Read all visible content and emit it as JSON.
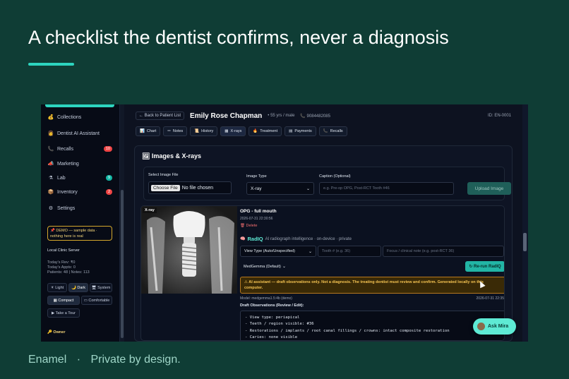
{
  "slide": {
    "title": "A checklist the dentist confirms, never a diagnosis",
    "footer_brand": "Enamel",
    "footer_sep": "·",
    "footer_tagline": "Private by design.",
    "accent_color": "#2dd4bf",
    "background_color": "#0f3d35"
  },
  "sidebar": {
    "items": [
      {
        "icon": "money-bag-icon",
        "glyph": "💰",
        "label": "Collections"
      },
      {
        "icon": "dentist-icon",
        "glyph": "👩",
        "label": "Dentist AI Assistant"
      },
      {
        "icon": "phone-icon",
        "glyph": "📞",
        "label": "Recalls",
        "badge": "10",
        "badge_color": "#ef4444"
      },
      {
        "icon": "megaphone-icon",
        "glyph": "📣",
        "label": "Marketing"
      },
      {
        "icon": "flask-icon",
        "glyph": "⚗",
        "label": "Lab",
        "badge": "9",
        "badge_color": "#14b8a6"
      },
      {
        "icon": "box-icon",
        "glyph": "📦",
        "label": "Inventory",
        "badge": "2",
        "badge_color": "#ef4444"
      },
      {
        "icon": "gear-icon",
        "glyph": "⚙",
        "label": "Settings"
      }
    ],
    "demo_line1": "📌 DEMO — sample data ·",
    "demo_line2": "nothing here is real",
    "server_label": "Local Clinic Server",
    "stats_rev": "Today's Rev: ₹0",
    "stats_appts": "Today's Appts: 0",
    "stats_counts": "Patients: 48 | Notes: 113",
    "theme_light": "☀ Light",
    "theme_dark": "🌙 Dark",
    "theme_system": "🖥 System",
    "density_compact": "▦ Compact",
    "density_comfortable": "▭ Comfortable",
    "tour": "▶ Take a Tour",
    "role": "🔑 Owner"
  },
  "patient": {
    "back": "← Back to Patient List",
    "name": "Emily Rose Chapman",
    "age_sex": "• 55 yrs / male",
    "phone": "📞 9084482085",
    "id": "ID: EN-0001"
  },
  "tabs": [
    {
      "glyph": "📊",
      "label": "Chart"
    },
    {
      "glyph": "✏",
      "label": "Notes"
    },
    {
      "glyph": "📜",
      "label": "History"
    },
    {
      "glyph": "▦",
      "label": "X-rays"
    },
    {
      "glyph": "🔥",
      "label": "Treatment"
    },
    {
      "glyph": "▤",
      "label": "Payments"
    },
    {
      "glyph": "📞",
      "label": "Recalls"
    }
  ],
  "images_card": {
    "title": "🖼 Images & X-rays",
    "select_label": "Select Image File",
    "file_button": "Choose File",
    "file_status": "No file chosen",
    "type_label": "Image Type",
    "type_value": "X-ray",
    "caption_label": "Caption (Optional)",
    "caption_placeholder": "e.g. Pre-op OPG, Post-RCT Tooth #46",
    "upload_button": "Upload Image"
  },
  "record": {
    "tag": "X-ray",
    "title": "OPG - full mouth",
    "date": "2026-07-31 22:30:56",
    "delete": "🗑 Delete",
    "radiq_name": "RadIQ",
    "radiq_desc": "AI radiograph intelligence · on-device · private",
    "view_type": "View Type (Auto/Unspecified)",
    "tooth_placeholder": "Tooth # (e.g. 36)",
    "focus_placeholder": "Focus / clinical note (e.g. post-RCT 36)",
    "model_select": "MedGemma (Default)",
    "rerun": "↻ Re-run RadIQ",
    "warning": "⚠ AI assistant — draft observations only. Not a diagnosis. The treating dentist must review and confirm. Generated locally on this computer.",
    "model_line": "Model: medgemma1.5:4b (demo)",
    "model_date": "2026-07-31 22:35",
    "draft_label": "Draft Observations (Review / Edit):",
    "draft_text": "- View type: periapical\n- Teeth / region visible: #36\n- Restorations / implants / root canal fillings / crowns: intact composite restoration\n- Caries: none visible\n- Bone quality & levels: crestal bone levels normal, no defect"
  },
  "assistant": {
    "button": "Ask Mira"
  }
}
